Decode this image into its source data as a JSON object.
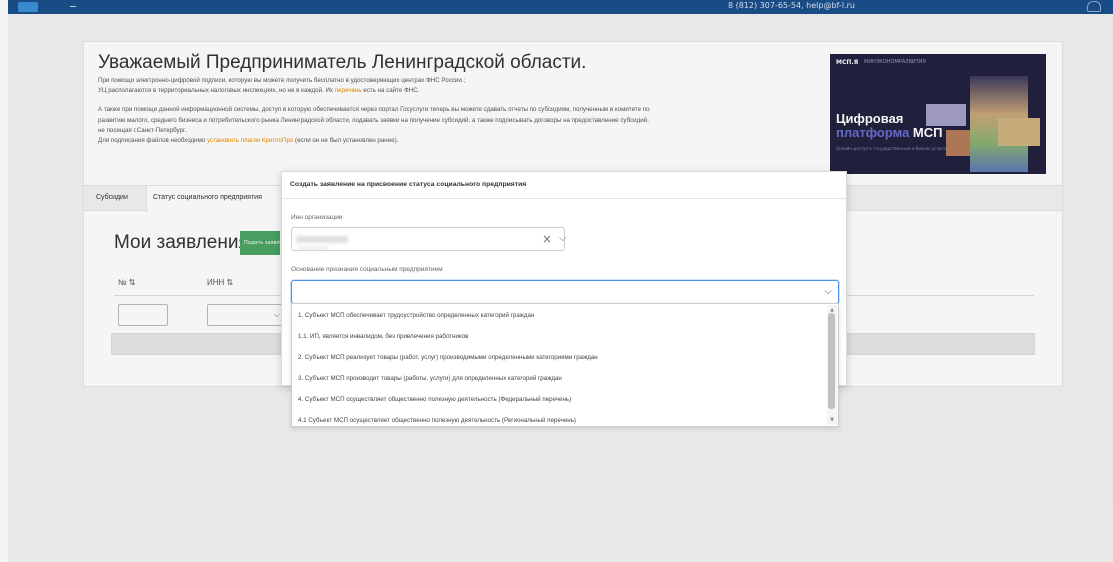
{
  "topbar": {
    "contacts": "8 (812) 307-65-54, help@bf-l.ru"
  },
  "info": {
    "heading": "Уважаемый Предприниматель Ленинградской области.",
    "line1": "При помощи электронно-цифровой подписи, которую вы можете получить бесплатно в удостоверяющих центрах ФНС России.;",
    "line2_pre": "УЦ располагаются в территориальных налоговых инспекциях, но не в каждой. Их ",
    "line2_link": "перечень",
    "line2_post": " есть на сайте ФНС.",
    "line3": "А также при помощи данной информационной системы, доступ в которую обеспечивается через портал Госуслуги теперь вы можете сдавать отчеты по субсидиям, полученным в комитете по",
    "line4": "развитию малого, среднего бизнеса и потребительского рынка Ленинградской области, подавать заявки на получение субсидий, а также подписывать договоры на предоставление субсидий,",
    "line5": "не посещая г.Санкт-Петербург.",
    "line6_pre": "Для подписания файлов необходимо ",
    "line6_link": "установить плагин КриптоПро",
    "line6_post": " (если он не был установлен ранее)."
  },
  "banner": {
    "logo_text": "МСП.Я",
    "logo_sub": "МИНЭКОНОМРАЗВИТИЯ",
    "title_line1": "Цифровая",
    "title_line2_accent": "платформа",
    "title_line2_rest": " МСП",
    "subtitle": "Онлайн-доступ к государственным и бизнес-услугам"
  },
  "tabs": {
    "subsidies": "Субсидии",
    "social_status": "Статус социального предприятия"
  },
  "applications": {
    "title": "Мои заявления",
    "apply_button": "Подать заявление",
    "col_number": "№ ⇅",
    "col_inn": "ИНН ⇅"
  },
  "modal": {
    "title": "Создать заявление на присвоение статуса социального предприятия",
    "inn_label": "Инн организации",
    "basis_label": "Основание признания социальным предприятием",
    "options": [
      "1. Субъект МСП обеспечивает трудоустройство определенных категорий граждан",
      "1.1. ИП, является инвалидом, без привлечения работников",
      "2. Субъект МСП реализует товары (работ, услуг) производимыми определенными категориями граждан",
      "3. Субъект МСП производит товары (работы, услуги) для определенных категорий граждан",
      "4. Субъект МСП осуществляет общественно полезную деятельность (Федеральный перечень)",
      "4.1 Субъект МСП осуществляет общественно полезную деятельность (Региональный перечень)"
    ]
  },
  "icons": {
    "clear": "×",
    "chevron": "⌵"
  }
}
